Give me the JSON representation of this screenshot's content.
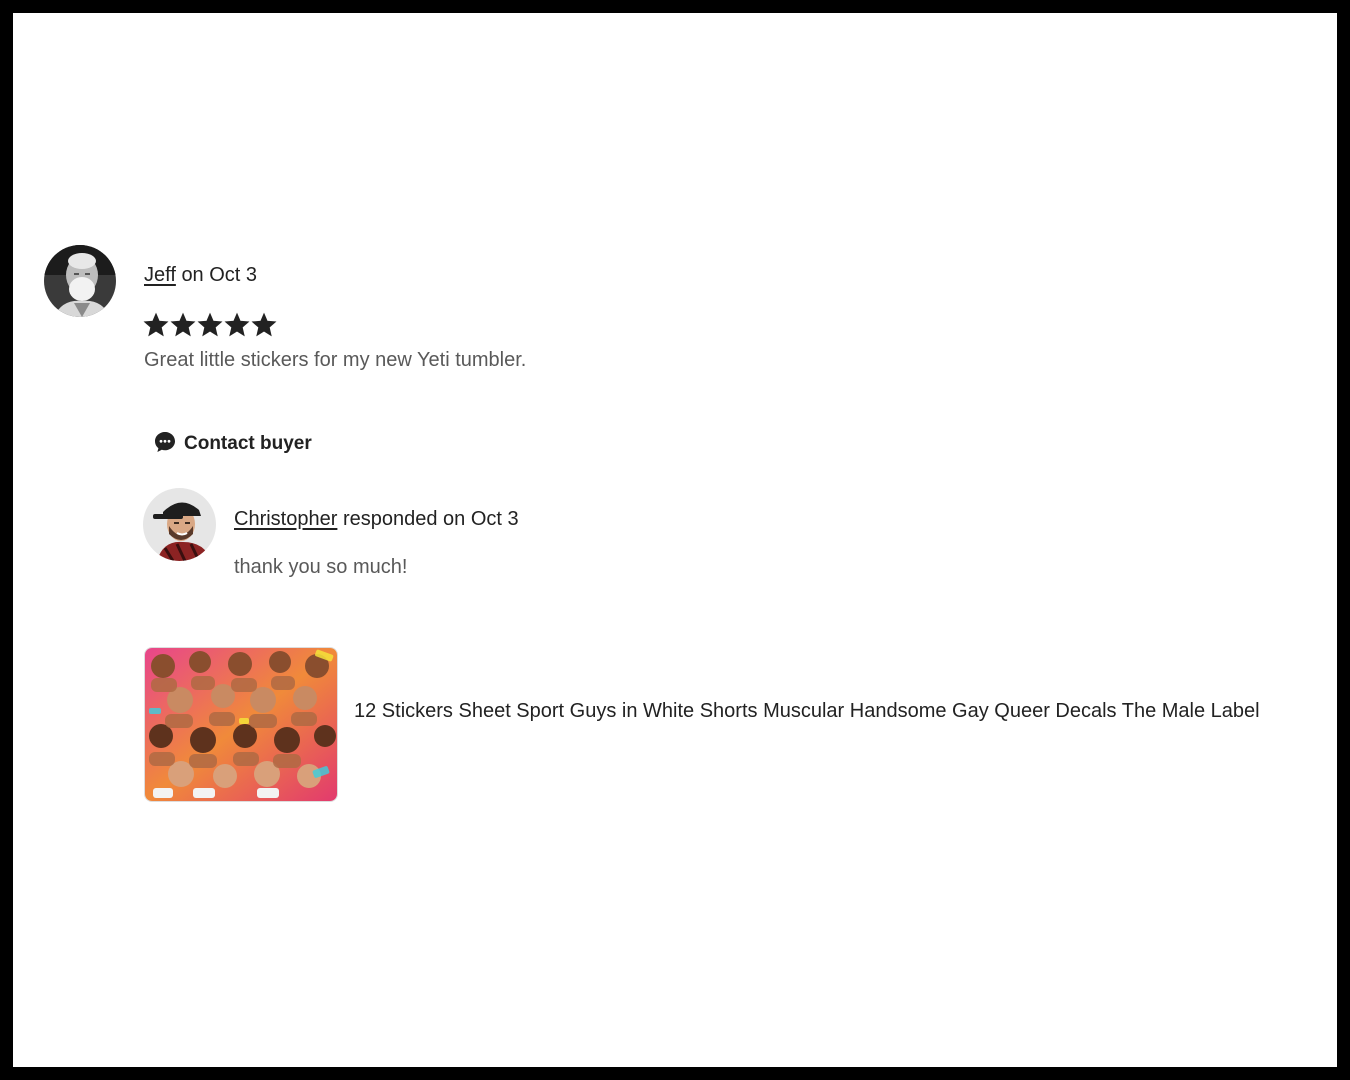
{
  "review": {
    "reviewer_name": "Jeff",
    "date_text": "on Oct 3",
    "rating": 5,
    "rating_max": 5,
    "text": "Great little stickers for my new Yeti tumbler."
  },
  "contact_button": {
    "label": "Contact buyer",
    "icon": "chat-bubble-icon"
  },
  "response": {
    "responder_name": "Christopher",
    "date_text": "responded on Oct 3",
    "text": "thank you so much!"
  },
  "listing": {
    "title": "12 Stickers Sheet Sport Guys in White Shorts Muscular Handsome Gay Queer Decals The Male Label"
  },
  "colors": {
    "text_primary": "#222222",
    "text_secondary": "#595959",
    "star": "#222222",
    "background": "#ffffff",
    "frame_border": "#000000"
  }
}
